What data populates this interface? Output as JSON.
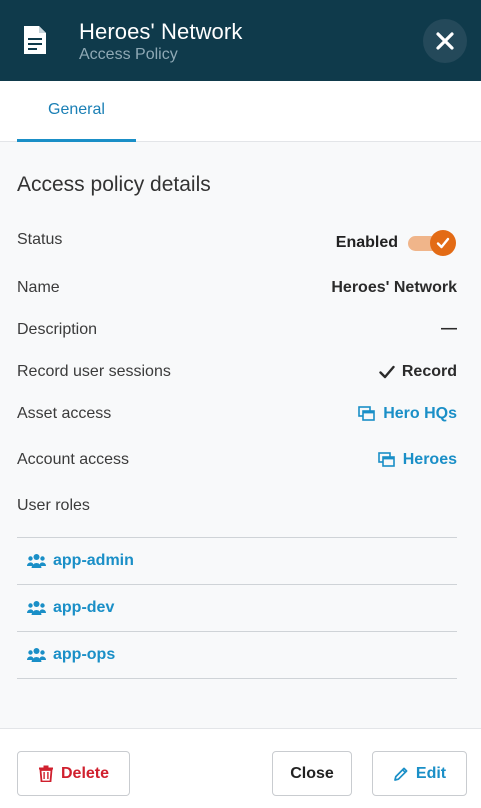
{
  "header": {
    "title": "Heroes' Network",
    "subtitle": "Access Policy",
    "icon": "document-icon",
    "close_icon": "close-icon"
  },
  "tabs": [
    {
      "label": "General",
      "active": true
    }
  ],
  "details": {
    "section_title": "Access policy details",
    "status": {
      "label": "Status",
      "value": "Enabled",
      "enabled": true
    },
    "name": {
      "label": "Name",
      "value": "Heroes' Network"
    },
    "description": {
      "label": "Description",
      "value": "—"
    },
    "record_sessions": {
      "label": "Record user sessions",
      "value": "Record",
      "icon": "checkmark-icon"
    },
    "asset_access": {
      "label": "Asset access",
      "value": "Hero HQs",
      "icon": "windows-icon"
    },
    "account_access": {
      "label": "Account access",
      "value": "Heroes",
      "icon": "windows-icon"
    },
    "user_roles": {
      "label": "User roles",
      "items": [
        {
          "label": "app-admin",
          "icon": "users-icon"
        },
        {
          "label": "app-dev",
          "icon": "users-icon"
        },
        {
          "label": "app-ops",
          "icon": "users-icon"
        }
      ]
    }
  },
  "footer": {
    "delete_label": "Delete",
    "close_label": "Close",
    "edit_label": "Edit"
  },
  "colors": {
    "header_bg": "#0f3a4b",
    "accent": "#1a8fc7",
    "toggle_on": "#e36b15",
    "danger": "#d0202e"
  }
}
